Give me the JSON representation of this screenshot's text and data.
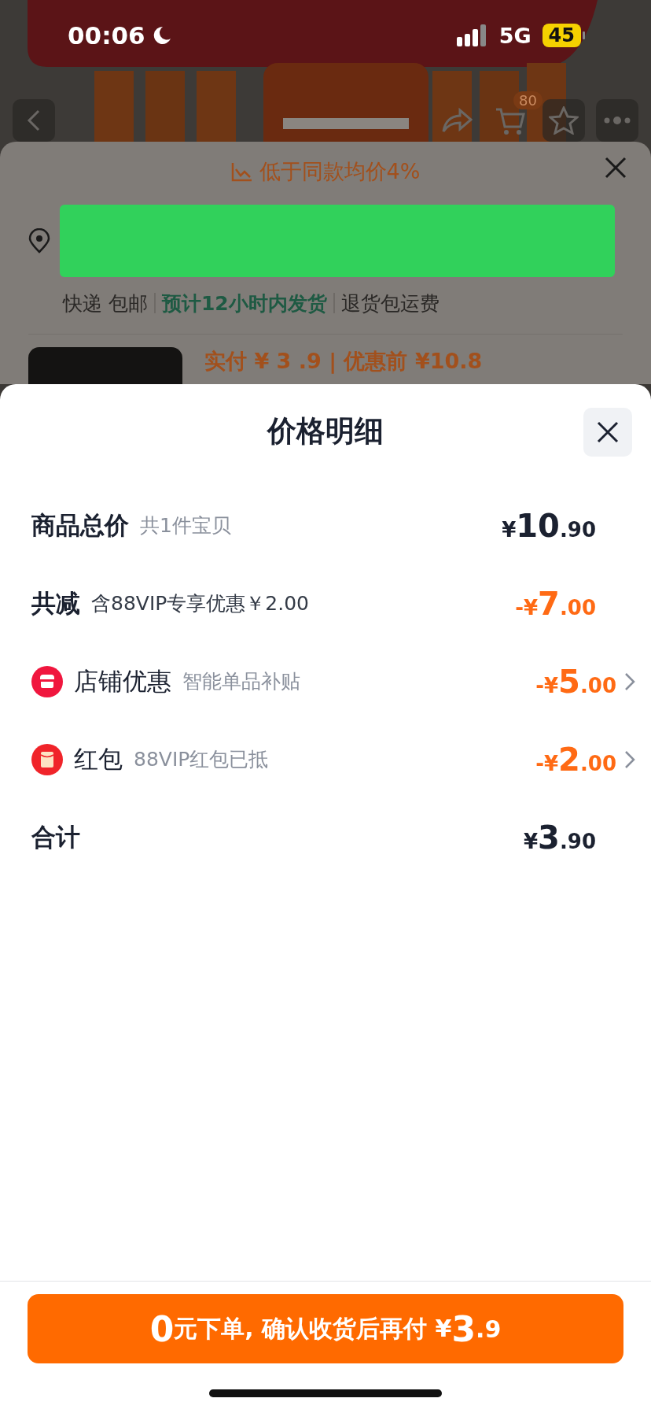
{
  "status_bar": {
    "time": "00:06",
    "network": "5G",
    "battery": "45"
  },
  "behind": {
    "cart_badge": "80",
    "price_hint": "低于同款均价4%",
    "delivery": [
      {
        "text": "快递 包邮",
        "highlight": false
      },
      {
        "text": "预计12小时内发货",
        "highlight": true
      },
      {
        "text": "退货包运费",
        "highlight": false
      }
    ],
    "product_price": "实付 ¥ 3 .9 | 优惠前 ¥10.8"
  },
  "sheet": {
    "title": "价格明细",
    "rows": [
      {
        "kind": "summary",
        "label": "商品总价",
        "note": "共1件宝贝",
        "discount": false,
        "price": {
          "symbol": "¥",
          "integer": "10",
          "decimal": ".90"
        }
      },
      {
        "kind": "summary",
        "label": "共减",
        "note": "含88VIP专享优惠￥2.00",
        "discount": true,
        "price": {
          "symbol": "-¥",
          "integer": "7",
          "decimal": ".00"
        }
      },
      {
        "kind": "shop",
        "label": "店铺优惠",
        "note": "智能单品补贴",
        "discount": true,
        "price": {
          "symbol": "-¥",
          "integer": "5",
          "decimal": ".00"
        }
      },
      {
        "kind": "packet",
        "label": "红包",
        "note": "88VIP红包已抵",
        "discount": true,
        "price": {
          "symbol": "-¥",
          "integer": "2",
          "decimal": ".00"
        }
      },
      {
        "kind": "total",
        "label": "合计",
        "discount": false,
        "price": {
          "symbol": "¥",
          "integer": "3",
          "decimal": ".90"
        }
      }
    ]
  },
  "order_button": [
    {
      "text": "0",
      "big": true
    },
    {
      "text": "元下单, 确认收货后再付 ¥",
      "big": false
    },
    {
      "text": "3",
      "big": true
    },
    {
      "text": ".9",
      "big": false
    }
  ]
}
